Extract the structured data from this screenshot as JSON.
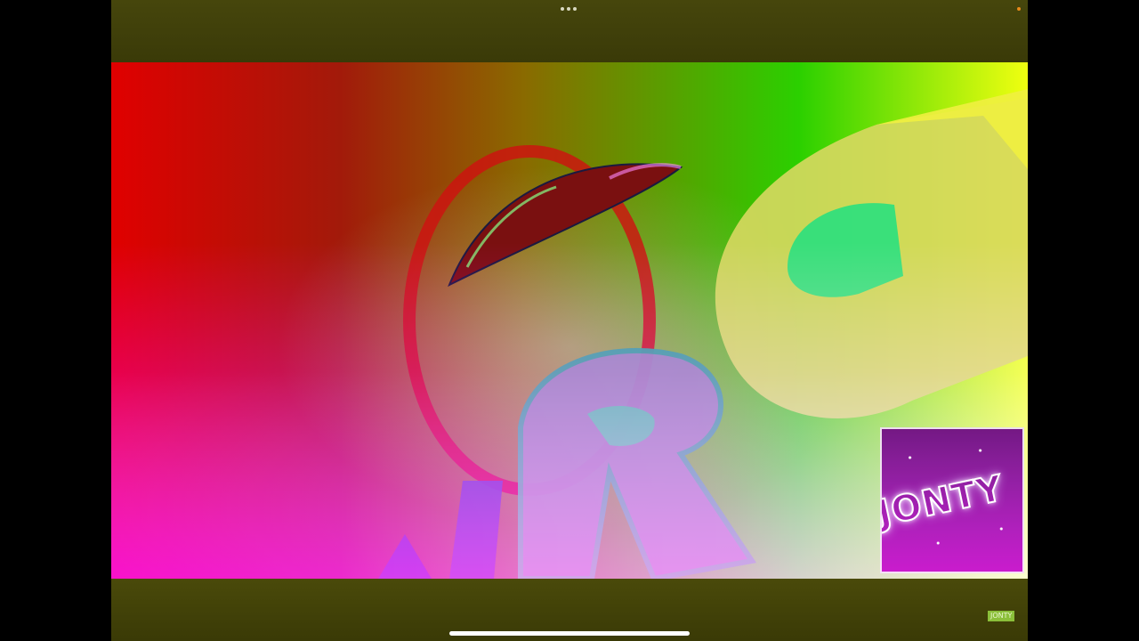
{
  "colors": {
    "frame_bg": "#3a3a08",
    "status_dot": "#e88a1a",
    "watermark_bg": "#8bbf3a"
  },
  "video": {
    "logo_letters": "RG",
    "thumbnail_text": "JONTY"
  },
  "watermark": {
    "label": "JONTY"
  },
  "icons": {
    "top_menu": "more-dots-icon",
    "status": "status-dot-icon"
  }
}
